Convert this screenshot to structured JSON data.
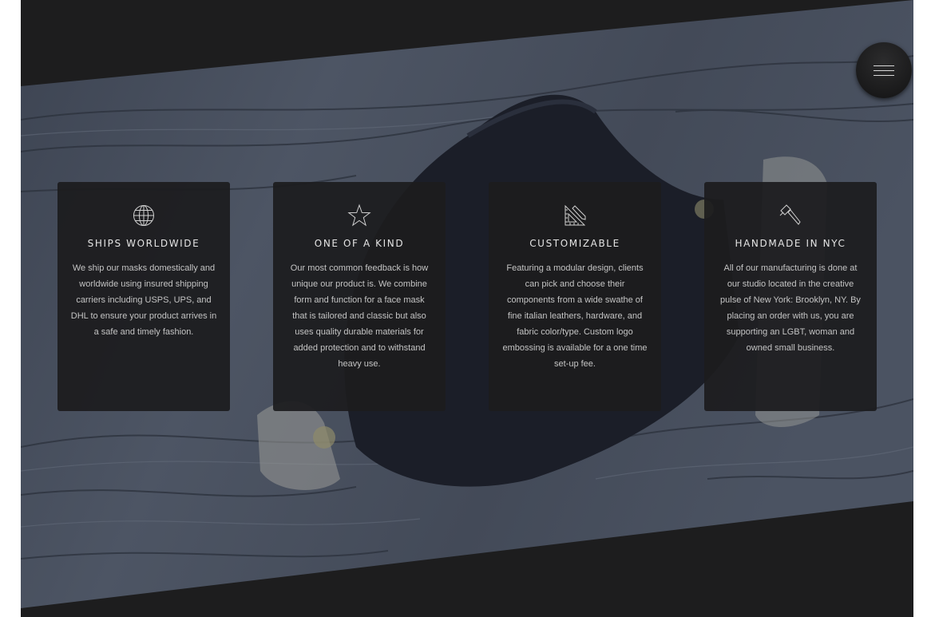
{
  "menu": {
    "icon": "hamburger-menu-icon"
  },
  "features": [
    {
      "icon": "globe-icon",
      "title": "SHIPS WORLDWIDE",
      "body": "We ship our masks domestically and worldwide using insured shipping carriers including USPS, UPS, and DHL to ensure your product arrives in a safe and timely fashion."
    },
    {
      "icon": "star-icon",
      "title": "ONE OF A KIND",
      "body": "Our most common feedback is how unique our product is. We combine form and function for a face mask that is tailored and classic but also uses quality durable materials for added protection and to withstand heavy use."
    },
    {
      "icon": "ruler-pencil-icon",
      "title": "CUSTOMIZABLE",
      "body": "Featuring a modular design, clients can pick and choose their components from a wide swathe of fine italian leathers, hardware, and fabric color/type. Custom logo embossing is available for a one time set-up fee."
    },
    {
      "icon": "hammer-icon",
      "title": "HANDMADE IN NYC",
      "body": "All of our manufacturing is done at our studio located in the creative pulse of New York: Brooklyn, NY. By placing an order with us, you are supporting an LGBT, woman and owned small business."
    }
  ]
}
